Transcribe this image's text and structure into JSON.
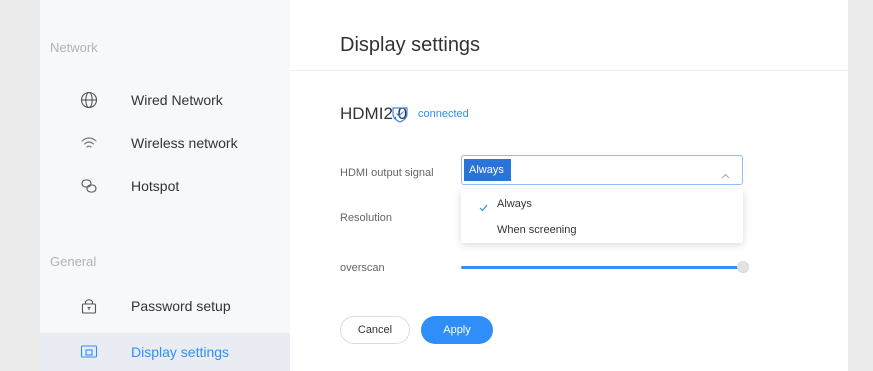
{
  "sidebar": {
    "network_label": "Network",
    "general_label": "General",
    "items": [
      {
        "label": "Wired Network",
        "icon": "globe-icon"
      },
      {
        "label": "Wireless network",
        "icon": "wifi-icon"
      },
      {
        "label": "Hotspot",
        "icon": "hotspot-icon"
      },
      {
        "label": "Password setup",
        "icon": "lock-icon"
      },
      {
        "label": "Display settings",
        "icon": "display-icon",
        "active": true
      }
    ]
  },
  "main": {
    "title": "Display settings",
    "device_name": "HDMI2.0",
    "status": "connected",
    "hdmi_output": {
      "label": "HDMI output signal",
      "value": "Always",
      "options": [
        "Always",
        "When screening"
      ],
      "selected_index": 0
    },
    "resolution_label": "Resolution",
    "overscan": {
      "label": "overscan",
      "value_fraction": 1.0
    },
    "buttons": {
      "cancel": "Cancel",
      "apply": "Apply"
    }
  },
  "colors": {
    "accent": "#2f8ef7",
    "highlight": "#2a73d8",
    "sidebar_bg": "#f7f8fa",
    "page_bg": "#ececec"
  }
}
